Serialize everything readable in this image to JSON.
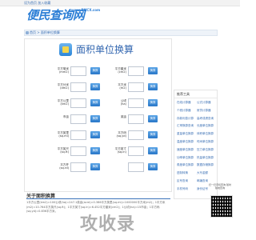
{
  "topbar": {
    "links": "设为首页 加入收藏"
  },
  "header": {
    "logo_main": "便民查询网",
    "logo_sub": "www.BMCX.com"
  },
  "breadcrumb": {
    "text": "首页 > 面积单位换算"
  },
  "page": {
    "title": "面积单位换算"
  },
  "converter": {
    "button_label": "换算",
    "rows": [
      {
        "left": "平方毫米\n(mm2)",
        "right": "平方厘米\n(cm2)"
      },
      {
        "left": "平方分米\n(dm2)",
        "right": "平方米\n(m2)"
      },
      {
        "left": "平方公里\n(km2)",
        "right": "公顷\n(ha)"
      },
      {
        "left": "市亩",
        "right": "英亩"
      },
      {
        "left": "平方英里\n(sq.mi)",
        "right": "平方码\n(sq.yd)"
      },
      {
        "left": "平方英尺\n(sq.ft)",
        "right": "平方英寸\n(sq.in)"
      },
      {
        "left": "平方杆\n(sq.rd)",
        "right": ""
      }
    ]
  },
  "about": {
    "title": "关于面积换算",
    "text": "1平方公里(km2)=100公顷(ha)=247.1英亩(acre)=0.386平方英里(sq.mi)=1000000平方米(m2)；1平方米(m2)=10.764平方英尺(sq.ft)；1平方英寸(sq.in)=6.452平方厘米(cm2)；1公顷(ha)=15市亩；1平方码(sq.yd)=0.836平方米。"
  },
  "sidebar": {
    "title": "推荐工具",
    "items": [
      "在线计算器",
      "公式计算器",
      "个税计算器",
      "房贷计算器",
      "存款利息计算",
      "高考成绩查询",
      "汇率换算查询",
      "长度单位换算",
      "重量单位换算",
      "体积单位换算",
      "温度单位换算",
      "时间单位换算",
      "速度单位换算",
      "压力单位换算",
      "功率单位换算",
      "热量单位换算",
      "角度单位换算",
      "数据存储换算",
      "进制转换",
      "大写金额",
      "区号查询",
      "邮编查询",
      "手机号码",
      "身份证号"
    ]
  },
  "qr": {
    "text": "扫一扫手机查询 随时随地查询"
  },
  "watermark": {
    "text": "攻收录"
  },
  "colors": {
    "accent": "#2d7fd6",
    "link": "#3a6fb4",
    "button": "#2a78c8"
  }
}
